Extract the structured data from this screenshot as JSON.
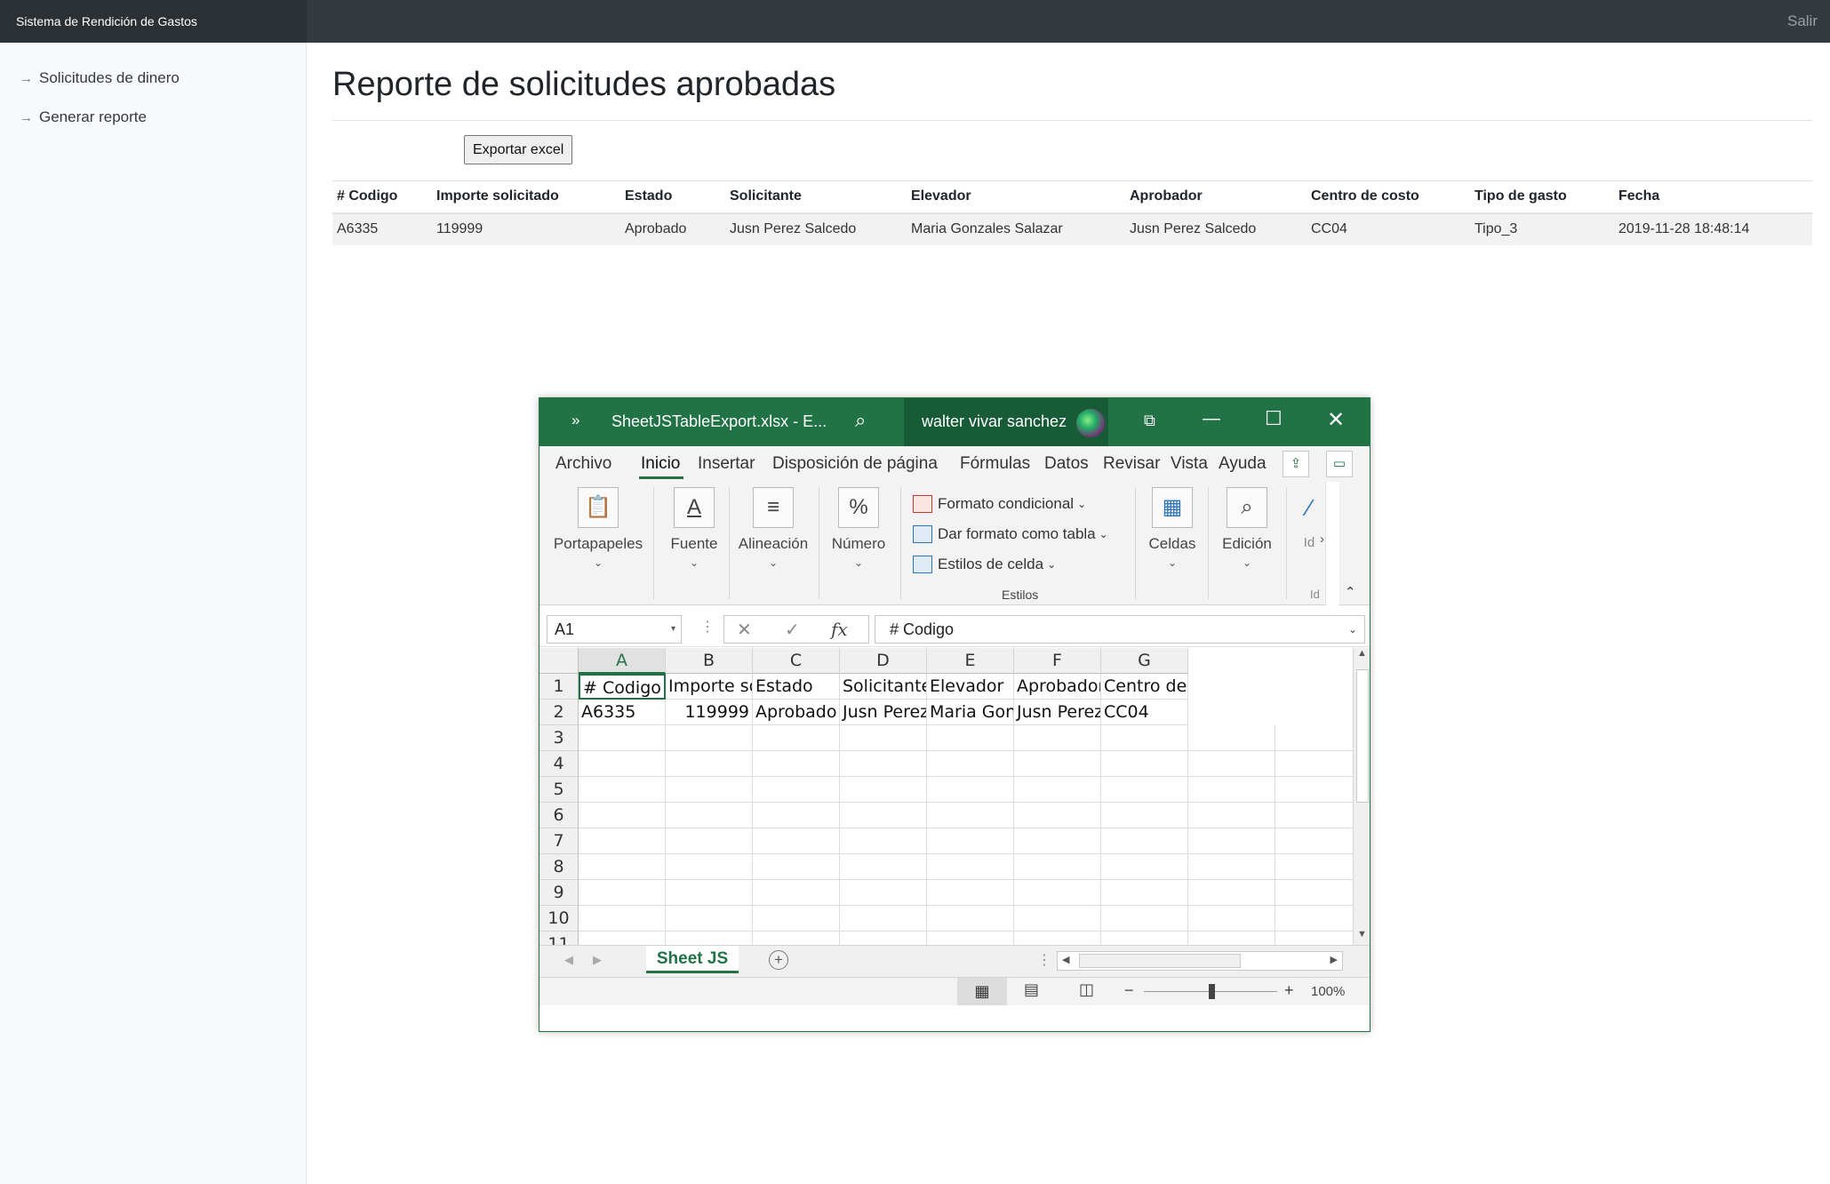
{
  "app": {
    "brand": "Sistema de Rendición de Gastos",
    "signout": "Salir"
  },
  "sidebar": {
    "items": [
      {
        "label": "Solicitudes de dinero"
      },
      {
        "label": "Generar reporte"
      }
    ]
  },
  "main": {
    "title": "Reporte de solicitudes aprobadas",
    "export_label": "Exportar excel",
    "table": {
      "headers": [
        "# Codigo",
        "Importe solicitado",
        "Estado",
        "Solicitante",
        "Elevador",
        "Aprobador",
        "Centro de costo",
        "Tipo de gasto",
        "Fecha"
      ],
      "rows": [
        [
          "A6335",
          "119999",
          "Aprobado",
          "Jusn Perez Salcedo",
          "Maria Gonzales Salazar",
          "Jusn Perez Salcedo",
          "CC04",
          "Tipo_3",
          "2019-11-28 18:48:14"
        ]
      ]
    }
  },
  "excel": {
    "filename": "SheetJSTableExport.xlsx  -  E...",
    "user": "walter vivar sanchez",
    "menu": [
      "Archivo",
      "Inicio",
      "Insertar",
      "Disposición de página",
      "Fórmulas",
      "Datos",
      "Revisar",
      "Vista",
      "Ayuda"
    ],
    "ribbon": {
      "portapapeles": "Portapapeles",
      "fuente": "Fuente",
      "alineacion": "Alineación",
      "numero": "Número",
      "formato_condicional": "Formato condicional",
      "dar_formato": "Dar formato como tabla",
      "estilos_celda": "Estilos de celda",
      "estilos_group": "Estilos",
      "celdas": "Celdas",
      "edicion": "Edición",
      "ideas_short": "Id",
      "ideas_label": "Id"
    },
    "namebox": "A1",
    "formula": "# Codigo",
    "columns": [
      "A",
      "B",
      "C",
      "D",
      "E",
      "F",
      "G"
    ],
    "rows": [
      [
        "# Codigo",
        "Importe solic",
        "Estado",
        "Solicitante",
        "Elevador",
        "Aprobador",
        "Centro de"
      ],
      [
        "A6335",
        "119999",
        "Aprobado",
        "Jusn Perez Sa",
        "Maria Gonza",
        "Jusn Perez Sa",
        "CC04"
      ]
    ],
    "row_numbers": [
      "1",
      "2",
      "3",
      "4",
      "5",
      "6",
      "7",
      "8",
      "9",
      "10",
      "11"
    ],
    "sheet_tab": "Sheet JS",
    "zoom": "100%",
    "icons": [
      "chevrons-icon",
      "search-icon",
      "ribbon-display-icon",
      "minimize-icon",
      "maximize-icon",
      "close-icon",
      "share-icon",
      "comment-icon"
    ]
  }
}
